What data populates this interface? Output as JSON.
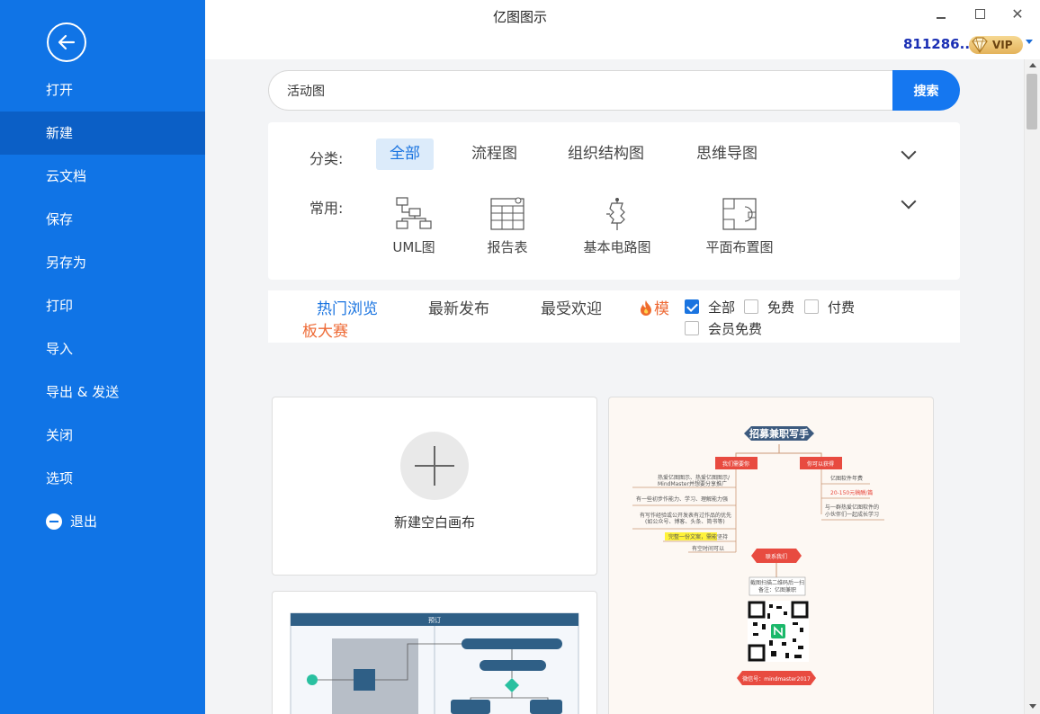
{
  "app": {
    "title": "亿图图示"
  },
  "user": {
    "id": "811286...",
    "vip_label": "VIP"
  },
  "sidebar": {
    "items": [
      {
        "label": "打开"
      },
      {
        "label": "新建"
      },
      {
        "label": "云文档"
      },
      {
        "label": "保存"
      },
      {
        "label": "另存为"
      },
      {
        "label": "打印"
      },
      {
        "label": "导入"
      },
      {
        "label": "导出 & 发送"
      },
      {
        "label": "关闭"
      },
      {
        "label": "选项"
      },
      {
        "label": "退出"
      }
    ],
    "active_index": 1
  },
  "search": {
    "value": "活动图",
    "button_label": "搜索"
  },
  "categories": {
    "label": "分类:",
    "items": [
      "全部",
      "流程图",
      "组织结构图",
      "思维导图"
    ],
    "active_index": 0
  },
  "common": {
    "label": "常用:",
    "items": [
      {
        "label": "UML图",
        "icon": "uml-icon"
      },
      {
        "label": "报告表",
        "icon": "report-icon"
      },
      {
        "label": "基本电路图",
        "icon": "circuit-icon"
      },
      {
        "label": "平面布置图",
        "icon": "floorplan-icon"
      }
    ]
  },
  "filter_tabs": {
    "items": [
      "热门浏览",
      "最新发布",
      "最受欢迎"
    ],
    "contest_line1": "模",
    "contest_line2": "板大赛",
    "active_index": 0
  },
  "price_filters": [
    {
      "label": "全部",
      "checked": true
    },
    {
      "label": "免费",
      "checked": false
    },
    {
      "label": "付费",
      "checked": false
    },
    {
      "label": "会员免费",
      "checked": false
    }
  ],
  "cards": {
    "new_blank_label": "新建空白画布",
    "recruit": {
      "title": "招募兼职写手",
      "left_tag": "我们需要你",
      "right_tag": "你可以获得",
      "left_lines": [
        "热爱亿图图示、热爱亿图图示/",
        "MindMaster并想要分享推广",
        "有一些初步作能力、学习、理解能力强",
        "有写作经验或公开发表有过作品的优先",
        "(如公众号、博客、头条、简书等)",
        "完整一份文案，需能坚持",
        "有空时间可以"
      ],
      "right_lines": [
        "亿图软件年费",
        "20-150元稿酬/篇",
        "与一群热爱亿图软件的",
        "小伙伴们一起成长学习"
      ],
      "contact_tag": "联系我们",
      "contact_line1": "截图扫描二维码后一扫",
      "contact_line2": "备注：亿图兼职",
      "wechat": "微信号：mindmaster2017"
    },
    "flow": {
      "header": "预订"
    }
  }
}
